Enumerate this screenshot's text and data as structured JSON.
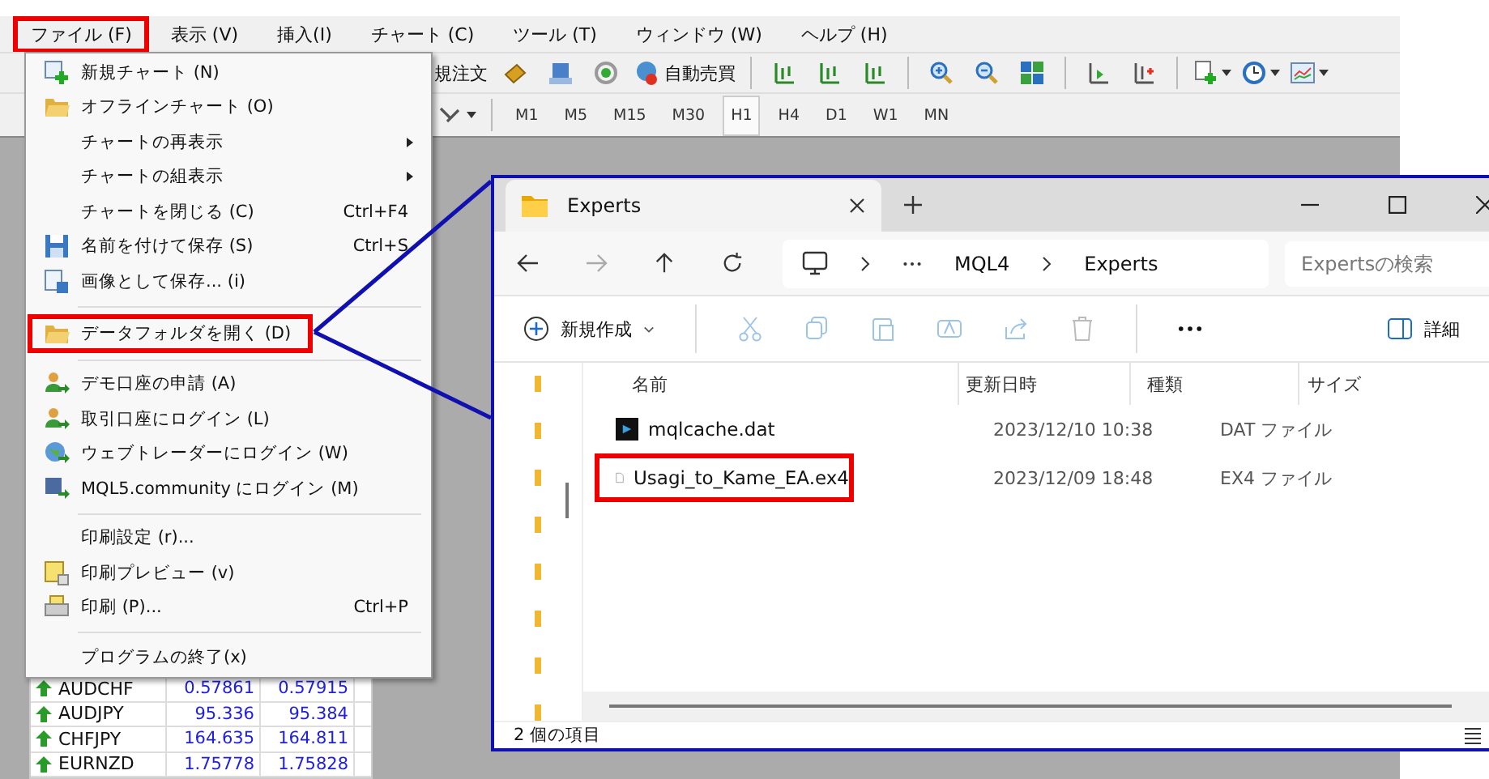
{
  "menubar": [
    {
      "label": "ファイル (F)",
      "highlighted": true
    },
    {
      "label": "表示 (V)",
      "highlighted": false
    },
    {
      "label": "挿入(I)",
      "highlighted": false
    },
    {
      "label": "チャート (C)",
      "highlighted": false
    },
    {
      "label": "ツール (T)",
      "highlighted": false
    },
    {
      "label": "ウィンドウ (W)",
      "highlighted": false
    },
    {
      "label": "ヘルプ (H)",
      "highlighted": false
    }
  ],
  "toolbar": {
    "order_label": "規注文",
    "autotrade_label": "自動売買"
  },
  "timeframes": [
    {
      "label": "M1",
      "selected": false
    },
    {
      "label": "M5",
      "selected": false
    },
    {
      "label": "M15",
      "selected": false
    },
    {
      "label": "M30",
      "selected": false
    },
    {
      "label": "H1",
      "selected": true
    },
    {
      "label": "H4",
      "selected": false
    },
    {
      "label": "D1",
      "selected": false
    },
    {
      "label": "W1",
      "selected": false
    },
    {
      "label": "MN",
      "selected": false
    }
  ],
  "file_menu": [
    {
      "kind": "item",
      "label": "新規チャート (N)",
      "submenu": false,
      "highlighted": false
    },
    {
      "kind": "item",
      "label": "オフラインチャート (O)",
      "submenu": false,
      "highlighted": false
    },
    {
      "kind": "item",
      "label": "チャートの再表示",
      "submenu": true,
      "highlighted": false
    },
    {
      "kind": "item",
      "label": "チャートの組表示",
      "submenu": true,
      "highlighted": false
    },
    {
      "kind": "item",
      "label": "チャートを閉じる (C)",
      "shortcut": "Ctrl+F4",
      "submenu": false,
      "highlighted": false
    },
    {
      "kind": "item",
      "label": "名前を付けて保存 (S)",
      "shortcut": "Ctrl+S",
      "submenu": false,
      "highlighted": false
    },
    {
      "kind": "item",
      "label": "画像として保存... (i)",
      "submenu": false,
      "highlighted": false
    },
    {
      "kind": "separator"
    },
    {
      "kind": "item",
      "label": "データフォルダを開く (D)",
      "submenu": false,
      "highlighted": true
    },
    {
      "kind": "separator"
    },
    {
      "kind": "item",
      "label": "デモ口座の申請 (A)",
      "submenu": false,
      "highlighted": false
    },
    {
      "kind": "item",
      "label": "取引口座にログイン (L)",
      "submenu": false,
      "highlighted": false
    },
    {
      "kind": "item",
      "label": "ウェブトレーダーにログイン (W)",
      "submenu": false,
      "highlighted": false
    },
    {
      "kind": "item",
      "label": "MQL5.community にログイン (M)",
      "submenu": false,
      "highlighted": false
    },
    {
      "kind": "separator"
    },
    {
      "kind": "item",
      "label": "印刷設定 (r)...",
      "submenu": false,
      "highlighted": false
    },
    {
      "kind": "item",
      "label": "印刷プレビュー (v)",
      "submenu": false,
      "highlighted": false
    },
    {
      "kind": "item",
      "label": "印刷 (P)...",
      "shortcut": "Ctrl+P",
      "submenu": false,
      "highlighted": false
    },
    {
      "kind": "separator"
    },
    {
      "kind": "item",
      "label": "プログラムの終了(x)",
      "submenu": false,
      "highlighted": false
    }
  ],
  "market_watch": {
    "rows": [
      {
        "symbol": "AUDCHF",
        "bid": "0.57861",
        "ask": "0.57915"
      },
      {
        "symbol": "AUDJPY",
        "bid": "95.336",
        "ask": "95.384"
      },
      {
        "symbol": "CHFJPY",
        "bid": "164.635",
        "ask": "164.811"
      },
      {
        "symbol": "EURNZD",
        "bid": "1.75778",
        "ask": "1.75828"
      }
    ]
  },
  "explorer": {
    "tab": {
      "title": "Experts"
    },
    "breadcrumb": [
      "MQL4",
      "Experts"
    ],
    "search": {
      "placeholder": "Expertsの検索"
    },
    "new_button": "新規作成",
    "details_button": "詳細",
    "columns": [
      "名前",
      "更新日時",
      "種類",
      "サイズ"
    ],
    "files": [
      {
        "kind": "dat",
        "name": "mqlcache.dat",
        "modified": "2023/12/10 10:38",
        "type": "DAT ファイル",
        "highlighted": false
      },
      {
        "kind": "file",
        "name": "Usagi_to_Kame_EA.ex4",
        "modified": "2023/12/09 18:48",
        "type": "EX4 ファイル",
        "highlighted": true
      }
    ],
    "status": "2 個の項目"
  }
}
